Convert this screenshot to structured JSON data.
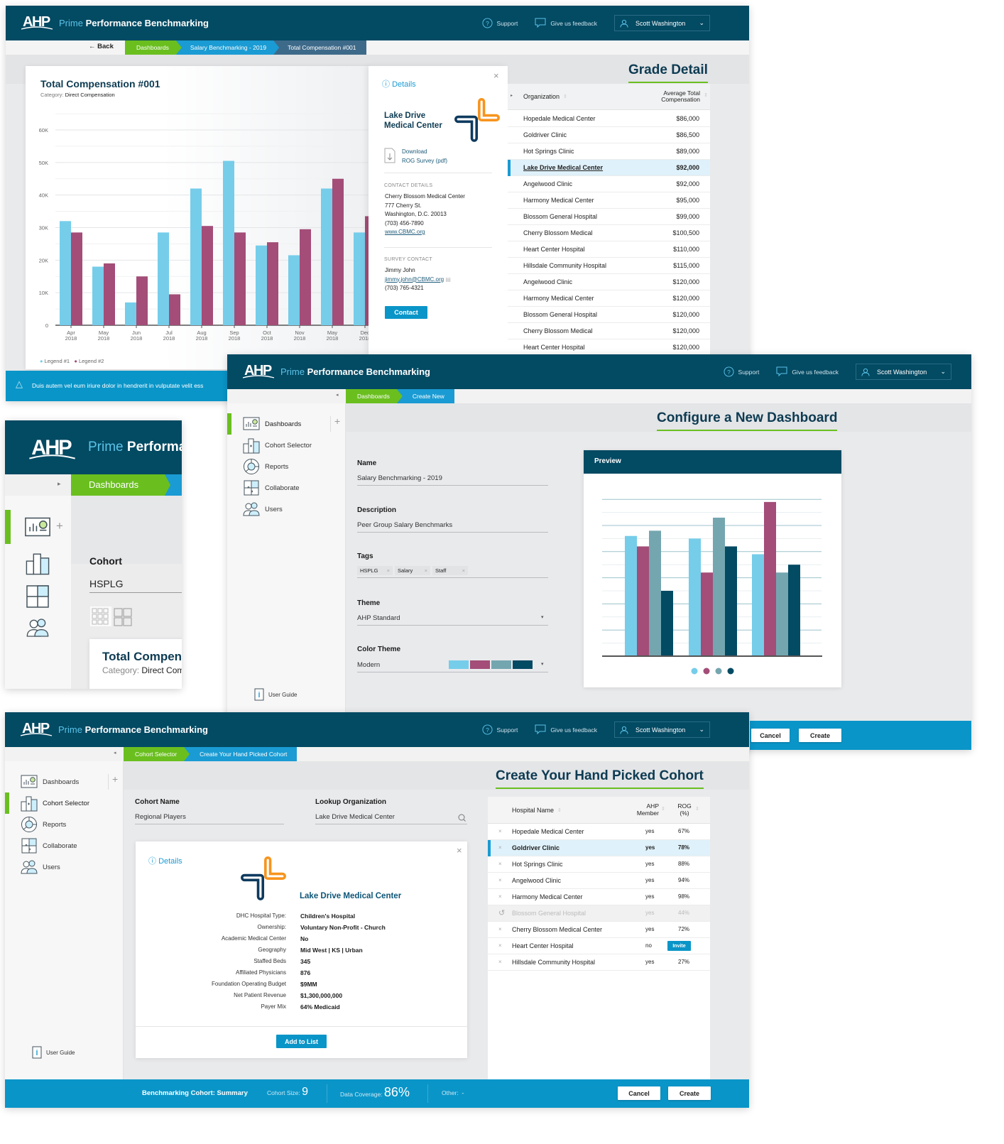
{
  "brand": {
    "logo": "AHP",
    "prime": "Prime",
    "title": "Performance Benchmarking",
    "support": "Support",
    "feedback": "Give us feedback",
    "user": "Scott Washington",
    "colors": {
      "header": "#034a63",
      "accent_green": "#6abf1f",
      "accent_blue": "#1a9bd3",
      "footer_blue": "#0a95c8",
      "series_1": "#75cdea",
      "series_2": "#a34d78",
      "series_3": "#74a6b0",
      "series_4": "#034a63",
      "logo_orange": "#f7941d",
      "logo_navy": "#0e3a5e"
    }
  },
  "nav": {
    "dashboards": "Dashboards",
    "cohort_selector": "Cohort Selector",
    "reports": "Reports",
    "collaborate": "Collaborate",
    "users": "Users",
    "user_guide": "User Guide"
  },
  "screen1": {
    "back": "Back",
    "breadcrumbs": [
      "Dashboards",
      "Salary Benchmarking - 2019",
      "Total Compensation #001"
    ],
    "card": {
      "title": "Total Compensation #001",
      "category_label": "Category:",
      "category": "Direct Compensation"
    },
    "legend": [
      "Legend #1",
      "Legend #2"
    ],
    "details": {
      "heading": "Details",
      "org_line1": "Lake Drive",
      "org_line2": "Medical Center",
      "download_line1": "Download",
      "download_line2": "ROG Survey (pdf)",
      "contact_heading": "CONTACT DETAILS",
      "contact_lines": [
        "Cherry Blossom Medical Center",
        "777 Cherry St.",
        "Washington, D.C. 20013",
        "(703) 456-7890"
      ],
      "website": "www.CBMC.org",
      "survey_heading": "SURVEY CONTACT",
      "survey_name": "Jimmy John",
      "survey_email": "jimmy.john@CBMC.org",
      "survey_phone": "(703) 765-4321",
      "contact_button": "Contact"
    },
    "grade": {
      "title": "Grade Detail",
      "col_org": "Organization",
      "col_comp_1": "Average Total",
      "col_comp_2": "Compensation",
      "selected_index": 3,
      "rows": [
        {
          "org": "Hopedale Medical Center",
          "value": "$86,000"
        },
        {
          "org": "Goldriver Clinic",
          "value": "$86,500"
        },
        {
          "org": "Hot Springs Clinic",
          "value": "$89,000"
        },
        {
          "org": "Lake Drive Medical Center",
          "value": "$92,000"
        },
        {
          "org": "Angelwood Clinic",
          "value": "$92,000"
        },
        {
          "org": "Harmony Medical Center",
          "value": "$95,000"
        },
        {
          "org": "Blossom General Hospital",
          "value": "$99,000"
        },
        {
          "org": "Cherry Blossom Medical",
          "value": "$100,500"
        },
        {
          "org": "Heart Center Hospital",
          "value": "$110,000"
        },
        {
          "org": "Hillsdale Community Hospital",
          "value": "$115,000"
        },
        {
          "org": "Angelwood Clinic",
          "value": "$120,000"
        },
        {
          "org": "Harmony Medical Center",
          "value": "$120,000"
        },
        {
          "org": "Blossom General Hospital",
          "value": "$120,000"
        },
        {
          "org": "Cherry Blossom Medical",
          "value": "$120,000"
        },
        {
          "org": "Heart Center Hospital",
          "value": "$120,000"
        }
      ]
    },
    "alert": "Duis autem vel eum iriure dolor in hendrerit in vulputate velit ess"
  },
  "screen_zoom": {
    "breadcrumb": "Dashboards",
    "cohort_label": "Cohort",
    "cohort_value": "HSPLG"
  },
  "screen2": {
    "breadcrumbs": [
      "Dashboards",
      "Create New"
    ],
    "title": "Configure a New Dashboard",
    "form": {
      "name_label": "Name",
      "name_value": "Salary Benchmarking - 2019",
      "description_label": "Description",
      "description_value": "Peer Group Salary Benchmarks",
      "tags_label": "Tags",
      "tags": [
        "HSPLG",
        "Salary",
        "Staff"
      ],
      "theme_label": "Theme",
      "theme_value": "AHP Standard",
      "color_theme_label": "Color Theme",
      "color_theme_value": "Modern",
      "swatches": [
        "#75cdea",
        "#a34d78",
        "#74a6b0",
        "#034a63"
      ]
    },
    "preview_title": "Preview",
    "cancel": "Cancel",
    "create": "Create"
  },
  "screen3": {
    "breadcrumbs": [
      "Cohort Selector",
      "Create Your Hand Picked Cohort"
    ],
    "title": "Create Your Hand Picked Cohort",
    "cohort_name_label": "Cohort Name",
    "cohort_name_value": "Regional Players",
    "lookup_label": "Lookup Organization",
    "lookup_value": "Lake Drive Medical Center",
    "details": {
      "heading": "Details",
      "org_name": "Lake Drive Medical Center",
      "fields": [
        {
          "label": "DHC Hospital Type:",
          "value": "Children's Hospital"
        },
        {
          "label": "Ownership:",
          "value": "Voluntary Non-Profit - Church"
        },
        {
          "label": "Academic Medical Center",
          "value": "No"
        },
        {
          "label": "Geography",
          "value": "Mid West  |  KS  |  Urban"
        },
        {
          "label": "Staffed Beds",
          "value": "345"
        },
        {
          "label": "Affiliated Physicians",
          "value": "876"
        },
        {
          "label": "Foundation Operating Budget",
          "value": "$9MM"
        },
        {
          "label": "Net Patient Revenue",
          "value": "$1,300,000,000"
        },
        {
          "label": "Payer Mix",
          "value": "64% Medicaid"
        }
      ],
      "add_button": "Add to List"
    },
    "table": {
      "col_name": "Hospital Name",
      "col_member_1": "AHP",
      "col_member_2": "Member",
      "col_rog_1": "ROG",
      "col_rog_2": "(%)",
      "invite": "Invite",
      "rows": [
        {
          "name": "Hopedale Medical Center",
          "member": "yes",
          "rog": "67%",
          "state": "normal"
        },
        {
          "name": "Goldriver Clinic",
          "member": "yes",
          "rog": "78%",
          "state": "selected"
        },
        {
          "name": "Hot Springs Clinic",
          "member": "yes",
          "rog": "88%",
          "state": "normal"
        },
        {
          "name": "Angelwood Clinic",
          "member": "yes",
          "rog": "94%",
          "state": "normal"
        },
        {
          "name": "Harmony Medical Center",
          "member": "yes",
          "rog": "98%",
          "state": "normal"
        },
        {
          "name": "Blossom General Hospital",
          "member": "yes",
          "rog": "44%",
          "state": "removed"
        },
        {
          "name": "Cherry Blossom Medical Center",
          "member": "yes",
          "rog": "72%",
          "state": "normal"
        },
        {
          "name": "Heart Center Hospital",
          "member": "no",
          "rog": "",
          "state": "invite"
        },
        {
          "name": "Hillsdale Community Hospital",
          "member": "yes",
          "rog": "27%",
          "state": "normal"
        }
      ]
    },
    "footer": {
      "summary": "Benchmarking Cohort: Summary",
      "size_label": "Cohort Size:",
      "size_value": "9",
      "coverage_label": "Data Coverage:",
      "coverage_value": "86%",
      "other_label": "Other:",
      "other_value": "-",
      "cancel": "Cancel",
      "create": "Create"
    }
  },
  "chart_data": [
    {
      "type": "bar",
      "categories": [
        "Apr 2018",
        "May 2018",
        "Jun 2018",
        "Jul 2018",
        "Aug 2018",
        "Sep 2018",
        "Oct 2018",
        "Nov 2018",
        "May 2018",
        "Dec 2018"
      ],
      "category_lines": [
        [
          "Apr",
          "2018"
        ],
        [
          "May",
          "2018"
        ],
        [
          "Jun",
          "2018"
        ],
        [
          "Jul",
          "2018"
        ],
        [
          "Aug",
          "2018"
        ],
        [
          "Sep",
          "2018"
        ],
        [
          "Oct",
          "2018"
        ],
        [
          "Nov",
          "2018"
        ],
        [
          "May",
          "2018"
        ],
        [
          "Dec",
          "2018"
        ]
      ],
      "series": [
        {
          "name": "Legend #1",
          "color": "#75cdea",
          "values": [
            32000,
            18000,
            7000,
            28500,
            42000,
            50500,
            24500,
            21500,
            42000,
            28500
          ]
        },
        {
          "name": "Legend #2",
          "color": "#a34d78",
          "values": [
            28500,
            19000,
            15000,
            9500,
            30500,
            28500,
            25500,
            29500,
            45000,
            33500
          ]
        }
      ],
      "yticks": [
        "0",
        "10K",
        "20K",
        "30K",
        "40K",
        "50K",
        "60K"
      ],
      "ytick_values": [
        0,
        10000,
        20000,
        30000,
        40000,
        50000,
        60000
      ],
      "ylim": [
        0,
        65000
      ],
      "grid": true,
      "legend": "bottom-left"
    },
    {
      "type": "bar",
      "groups": 3,
      "series": [
        {
          "color": "#75cdea",
          "values": [
            4.6,
            4.5,
            3.9
          ]
        },
        {
          "color": "#a34d78",
          "values": [
            4.2,
            3.2,
            5.9
          ]
        },
        {
          "color": "#74a6b0",
          "values": [
            4.8,
            5.3,
            3.2
          ]
        },
        {
          "color": "#034a63",
          "values": [
            2.5,
            4.2,
            3.5
          ]
        }
      ],
      "ylim": [
        0,
        6
      ],
      "grid": true,
      "legend": "bottom-center"
    }
  ]
}
